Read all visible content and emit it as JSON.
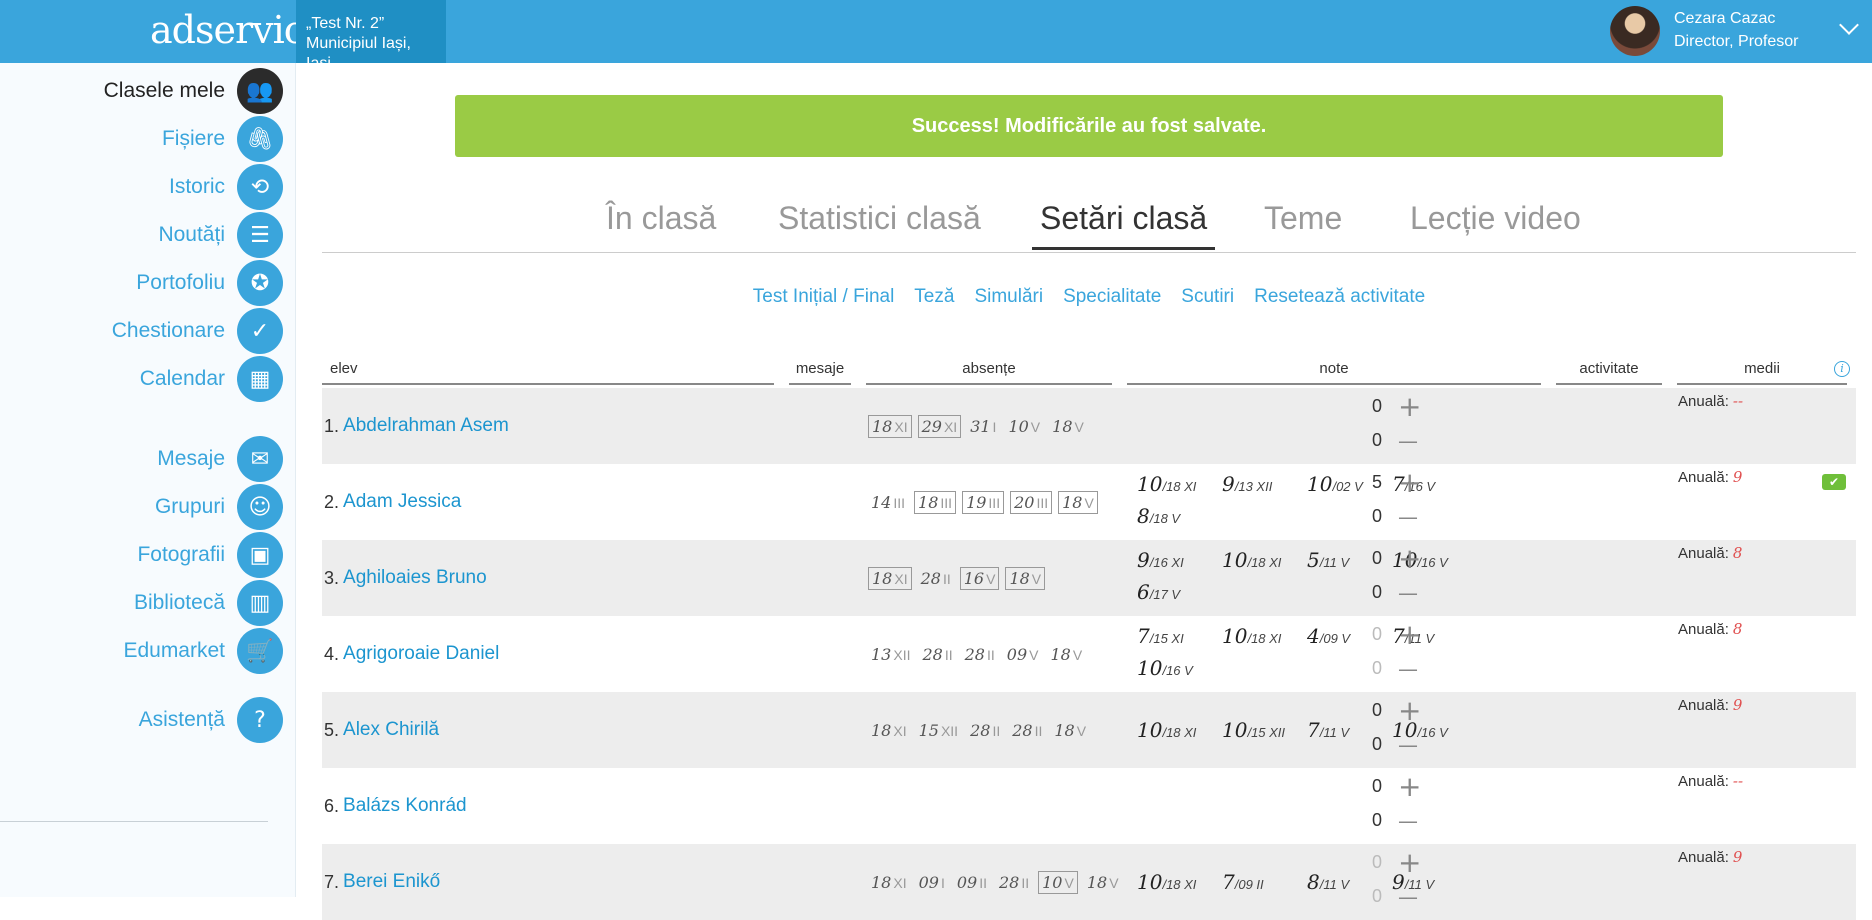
{
  "header": {
    "logo": "adservio",
    "school_line1": "„Test Nr. 2”",
    "school_line2": "Municipiul Iași, Iași",
    "user_name": "Cezara Cazac",
    "user_role": "Director, Profesor"
  },
  "sidebar": {
    "items": [
      {
        "label": "Clasele mele",
        "icon": "classes-icon",
        "glyph": "👥",
        "active": true
      },
      {
        "label": "Fișiere",
        "icon": "paperclip-icon",
        "glyph": "🖇"
      },
      {
        "label": "Istoric",
        "icon": "history-icon",
        "glyph": "⟲"
      },
      {
        "label": "Noutăți",
        "icon": "news-icon",
        "glyph": "☰"
      },
      {
        "label": "Portofoliu",
        "icon": "portfolio-icon",
        "glyph": "✪"
      },
      {
        "label": "Chestionare",
        "icon": "survey-icon",
        "glyph": "✓"
      },
      {
        "label": "Calendar",
        "icon": "calendar-icon",
        "glyph": "▦"
      },
      {
        "label": "Mesaje",
        "icon": "envelope-icon",
        "glyph": "✉"
      },
      {
        "label": "Grupuri",
        "icon": "groups-icon",
        "glyph": "☺"
      },
      {
        "label": "Fotografii",
        "icon": "photos-icon",
        "glyph": "▣"
      },
      {
        "label": "Bibliotecă",
        "icon": "library-icon",
        "glyph": "▥"
      },
      {
        "label": "Edumarket",
        "icon": "cart-icon",
        "glyph": "🛒"
      },
      {
        "label": "Asistență",
        "icon": "help-icon",
        "glyph": "?"
      }
    ]
  },
  "alert": {
    "text": "Success! Modificările au fost salvate."
  },
  "tabs": [
    "În clasă",
    "Statistici clasă",
    "Setări clasă",
    "Teme",
    "Lecție video"
  ],
  "active_tab": 2,
  "subnav": [
    "Test Inițial / Final",
    "Teză",
    "Simulări",
    "Specialitate",
    "Scutiri",
    "Resetează activitate"
  ],
  "columns": {
    "elev": "elev",
    "mesaje": "mesaje",
    "absente": "absențe",
    "note": "note",
    "activitate": "activitate",
    "medii": "medii"
  },
  "mean_label": "Anuală:",
  "students": [
    {
      "num": "1.",
      "name": "Abdelrahman Asem",
      "absences": [
        [
          "18",
          "XI",
          true
        ],
        [
          "29",
          "XI",
          true
        ],
        [
          "31",
          "I",
          false
        ],
        [
          "10",
          "V",
          false
        ],
        [
          "18",
          "V",
          false
        ]
      ],
      "notes": [],
      "act_plus": "0",
      "act_minus": "0",
      "muted": false,
      "mean": "--",
      "checked": false
    },
    {
      "num": "2.",
      "name": "Adam Jessica",
      "absences": [
        [
          "14",
          "III",
          false
        ],
        [
          "18",
          "III",
          true
        ],
        [
          "19",
          "III",
          true
        ],
        [
          "20",
          "III",
          true
        ],
        [
          "18",
          "V",
          true
        ]
      ],
      "notes": [
        [
          "10",
          "/18 XI"
        ],
        [
          "9",
          "/13 XII"
        ],
        [
          "10",
          "/02 V"
        ],
        [
          "7",
          "/16 V"
        ],
        [
          "8",
          "/18 V"
        ]
      ],
      "act_plus": "5",
      "act_minus": "0",
      "muted": false,
      "mean": "9",
      "checked": true
    },
    {
      "num": "3.",
      "name": "Aghiloaies Bruno",
      "absences": [
        [
          "18",
          "XI",
          true
        ],
        [
          "28",
          "II",
          false
        ],
        [
          "16",
          "V",
          true
        ],
        [
          "18",
          "V",
          true
        ]
      ],
      "notes": [
        [
          "9",
          "/16 XI"
        ],
        [
          "10",
          "/18 XI"
        ],
        [
          "5",
          "/11 V"
        ],
        [
          "10",
          "/16 V"
        ],
        [
          "6",
          "/17 V"
        ]
      ],
      "act_plus": "0",
      "act_minus": "0",
      "muted": false,
      "mean": "8",
      "checked": false
    },
    {
      "num": "4.",
      "name": "Agrigoroaie Daniel",
      "absences": [
        [
          "13",
          "XII",
          false
        ],
        [
          "28",
          "II",
          false
        ],
        [
          "28",
          "II",
          false
        ],
        [
          "09",
          "V",
          false
        ],
        [
          "18",
          "V",
          false
        ]
      ],
      "notes": [
        [
          "7",
          "/15 XI"
        ],
        [
          "10",
          "/18 XI"
        ],
        [
          "4",
          "/09 V"
        ],
        [
          "7",
          "/11 V"
        ],
        [
          "10",
          "/16 V"
        ]
      ],
      "act_plus": "0",
      "act_minus": "0",
      "muted": true,
      "mean": "8",
      "checked": false
    },
    {
      "num": "5.",
      "name": "Alex Chirilă",
      "absences": [
        [
          "18",
          "XI",
          false
        ],
        [
          "15",
          "XII",
          false
        ],
        [
          "28",
          "II",
          false
        ],
        [
          "28",
          "II",
          false
        ],
        [
          "18",
          "V",
          false
        ]
      ],
      "notes": [
        [
          "10",
          "/18 XI"
        ],
        [
          "10",
          "/15 XII"
        ],
        [
          "7",
          "/11 V"
        ],
        [
          "10",
          "/16 V"
        ]
      ],
      "act_plus": "0",
      "act_minus": "0",
      "muted": false,
      "mean": "9",
      "checked": false
    },
    {
      "num": "6.",
      "name": "Balázs Konrád",
      "absences": [],
      "notes": [],
      "act_plus": "0",
      "act_minus": "0",
      "muted": false,
      "mean": "--",
      "checked": false
    },
    {
      "num": "7.",
      "name": "Berei Enikő",
      "absences": [
        [
          "18",
          "XI",
          false
        ],
        [
          "09",
          "I",
          false
        ],
        [
          "09",
          "II",
          false
        ],
        [
          "28",
          "II",
          false
        ],
        [
          "10",
          "V",
          true
        ],
        [
          "18",
          "V",
          false
        ]
      ],
      "notes": [
        [
          "10",
          "/18 XI"
        ],
        [
          "7",
          "/09 II"
        ],
        [
          "8",
          "/11 V"
        ],
        [
          "9",
          "/11 V"
        ]
      ],
      "act_plus": "0",
      "act_minus": "0",
      "muted": true,
      "mean": "9",
      "checked": false
    }
  ]
}
